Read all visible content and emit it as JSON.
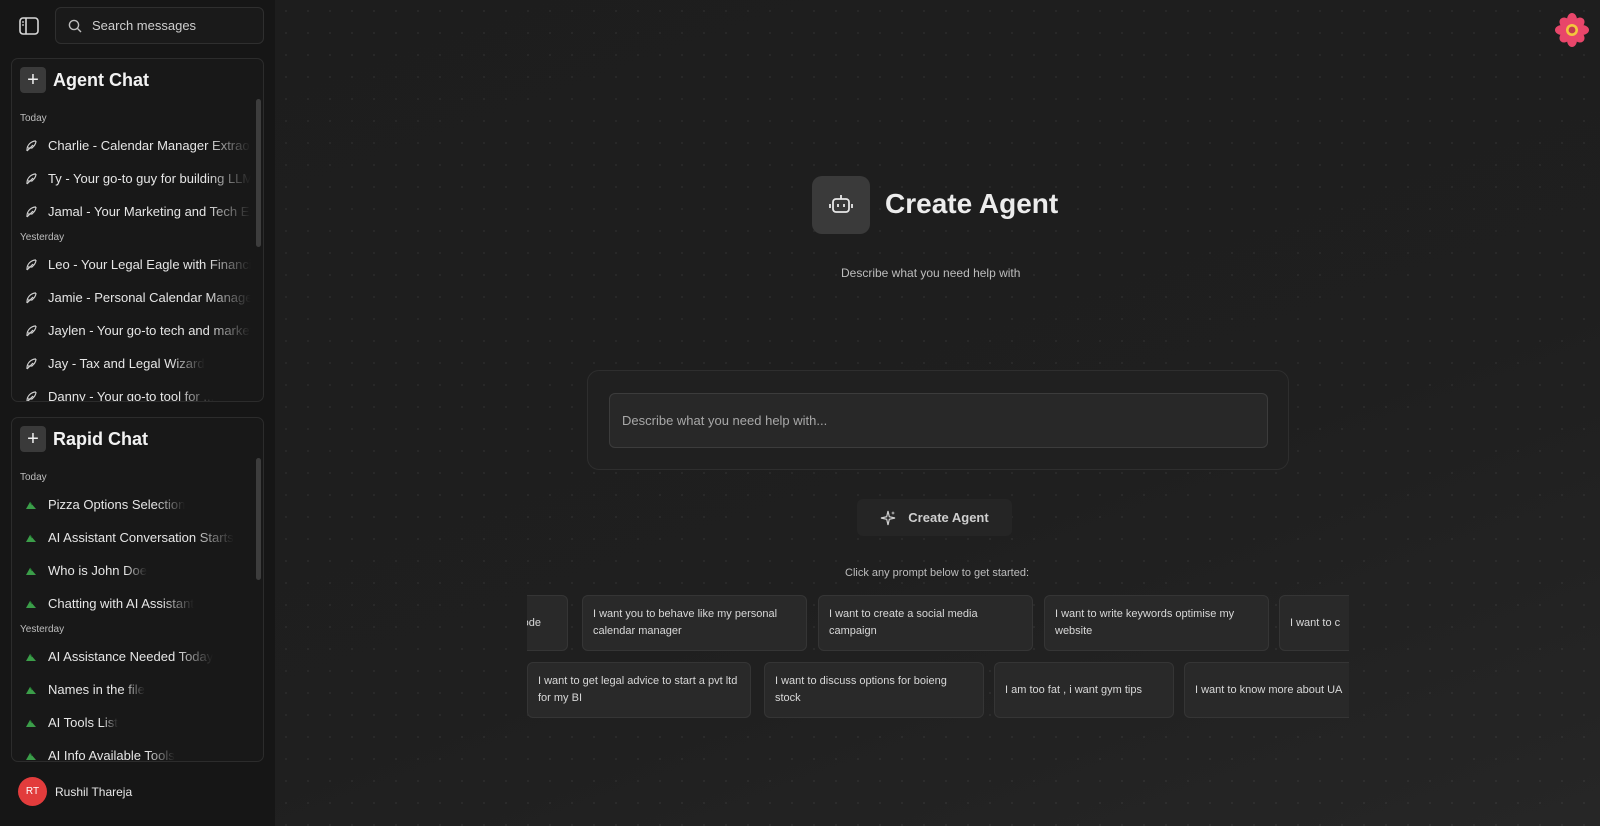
{
  "search": {
    "placeholder": "Search messages"
  },
  "agent_panel": {
    "title": "Agent Chat",
    "groups": [
      {
        "label": "Today",
        "items": [
          "Charlie - Calendar Manager Extraordinaire",
          "Ty - Your go-to guy for building LLM",
          "Jamal - Your Marketing and Tech Expert"
        ]
      },
      {
        "label": "Yesterday",
        "items": [
          "Leo - Your Legal Eagle with Financial",
          "Jamie - Personal Calendar Manager",
          "Jaylen - Your go-to tech and marketing",
          "Jay - Tax and Legal Wizard",
          "Danny - Your go-to tool for ..."
        ]
      }
    ]
  },
  "rapid_panel": {
    "title": "Rapid Chat",
    "groups": [
      {
        "label": "Today",
        "items": [
          "Pizza Options Selection",
          "AI Assistant Conversation Starts",
          "Who is John Doe",
          "Chatting with AI Assistant"
        ]
      },
      {
        "label": "Yesterday",
        "items": [
          "AI Assistance Needed Today",
          "Names in the file",
          "AI Tools List",
          "AI Info Available Tools"
        ]
      }
    ]
  },
  "user": {
    "initials": "RT",
    "name": "Rushil Thareja"
  },
  "hero": {
    "title": "Create Agent",
    "subtitle": "Describe what you need help with"
  },
  "prompt": {
    "placeholder": "Describe what you need help with..."
  },
  "create_button": {
    "label": "Create Agent"
  },
  "hint": "Click any prompt below to get started:",
  "chips_row1": [
    "n code",
    "I want you to behave like my personal calendar manager",
    "I want to create a social media campaign",
    "I want to write keywords optimise my website",
    "I want to c"
  ],
  "chips_row2": [
    "I want to get legal advice to start a pvt ltd for my BI",
    "I want to discuss options for boieng stock",
    "I am too fat , i want gym tips",
    "I want to know more about UA"
  ],
  "colors": {
    "avatar": "#e23c3c",
    "logo_outer": "#e8466a",
    "logo_inner": "#f3c63d"
  }
}
